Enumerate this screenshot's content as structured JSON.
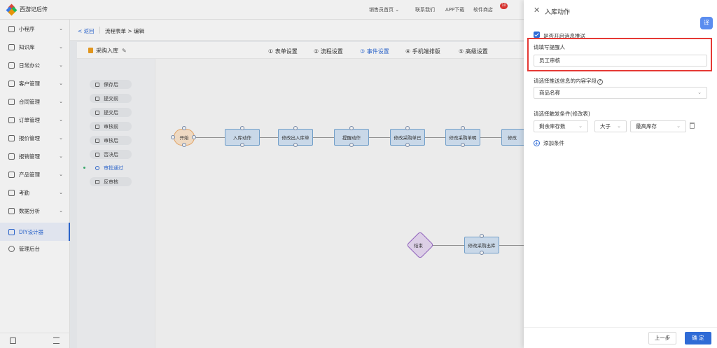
{
  "app": {
    "brand": "西游记后传"
  },
  "topnav": [
    {
      "label": "销售员首页 ⌄"
    },
    {
      "label": "联系我们"
    },
    {
      "label": "APP下载"
    },
    {
      "label": "软件商店"
    }
  ],
  "topnav_badge": "10",
  "sidebar": {
    "items": [
      {
        "label": "小程序",
        "chev": "⌄"
      },
      {
        "label": "知识库",
        "chev": "⌄"
      },
      {
        "label": "日常办公",
        "chev": "⌄"
      },
      {
        "label": "客户管理",
        "chev": "⌄"
      },
      {
        "label": "合同管理",
        "chev": "⌄"
      },
      {
        "label": "订单管理",
        "chev": "⌄"
      },
      {
        "label": "报价管理",
        "chev": "⌄"
      },
      {
        "label": "报销管理",
        "chev": "⌄"
      },
      {
        "label": "产品管理",
        "chev": "⌄"
      },
      {
        "label": "考勤",
        "chev": "⌄"
      },
      {
        "label": "数据分析",
        "chev": "⌄"
      },
      {
        "label": "DIY设计器",
        "chev": ""
      },
      {
        "label": "管理后台",
        "chev": ""
      }
    ]
  },
  "breadcrumb": {
    "back": "< 返回",
    "path": "流程表单 > 编辑"
  },
  "form": {
    "title": "采购入库",
    "steps": [
      "① 表单设置",
      "② 流程设置",
      "③ 事件设置",
      "④ 手机端排版",
      "⑤ 高级设置"
    ]
  },
  "events": [
    "保存后",
    "提交前",
    "提交后",
    "审核前",
    "审核后",
    "否决后",
    "审批通过",
    "反审核"
  ],
  "flow": {
    "row1": [
      "开始",
      "入库动作",
      "修改出入库单",
      "提醒动作",
      "修改采购单已",
      "修改采购单明",
      "修改"
    ],
    "row2": [
      "结束",
      "修改采购出库"
    ]
  },
  "drawer": {
    "close": "✕",
    "title": "入库动作",
    "translate": "译",
    "push_enabled_label": "是否开启消息推送",
    "push_enabled": true,
    "reminder_label": "请填写提醒人",
    "reminder_value": "员工审核",
    "content_field_label": "请选择推送信息的内容字段",
    "help": "?",
    "content_field_value": "商品名称",
    "trigger_label": "请选择触发条件(修改表)",
    "trigger_field": "剩余库存数",
    "trigger_op": "大于",
    "trigger_value": "最高库存",
    "add_condition": "添加条件",
    "prev": "上一步",
    "ok": "确 定"
  }
}
